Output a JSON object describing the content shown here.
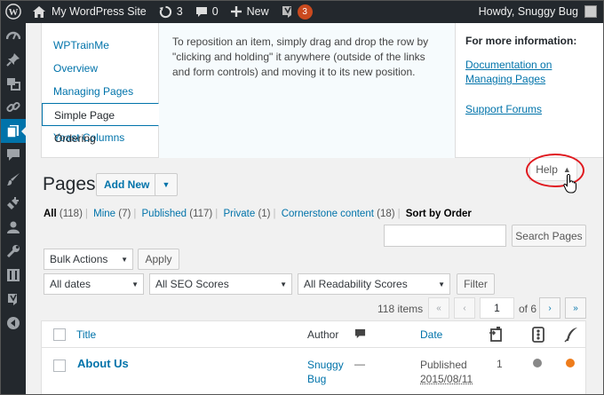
{
  "adminbar": {
    "site_name": "My WordPress Site",
    "updates_count": "3",
    "comments_count": "0",
    "new_label": "New",
    "yoast_badge": "3",
    "howdy": "Howdy, Snuggy Bug"
  },
  "help": {
    "tabs": [
      "WPTrainMe",
      "Overview",
      "Managing Pages",
      "Simple Page Ordering",
      "Yoast Columns"
    ],
    "active_tab": "Simple Page Ordering",
    "text": "To reposition an item, simply drag and drop the row by \"clicking and holding\" it anywhere (outside of the links and form controls) and moving it to its new position.",
    "side_heading": "For more information:",
    "side_links": [
      "Documentation on Managing Pages",
      "Support Forums"
    ],
    "toggle_label": "Help"
  },
  "page": {
    "title": "Pages",
    "add_new": "Add New"
  },
  "filters": {
    "all": "All",
    "all_count": "(118)",
    "mine": "Mine",
    "mine_count": "(7)",
    "published": "Published",
    "published_count": "(117)",
    "private": "Private",
    "private_count": "(1)",
    "cornerstone": "Cornerstone content",
    "cornerstone_count": "(18)",
    "sort_by_order": "Sort by Order"
  },
  "search": {
    "button": "Search Pages"
  },
  "bulk": {
    "selected": "Bulk Actions",
    "apply": "Apply"
  },
  "dropdowns": {
    "dates": "All dates",
    "seo": "All SEO Scores",
    "readability": "All Readability Scores",
    "filter": "Filter"
  },
  "pagination": {
    "items": "118 items",
    "first": "«",
    "prev": "‹",
    "current": "1",
    "of": "of 6",
    "next": "›",
    "last": "»"
  },
  "table": {
    "headers": {
      "title": "Title",
      "author": "Author",
      "date": "Date"
    },
    "rows": [
      {
        "title": "About Us",
        "author": "Snuggy Bug",
        "comments": "—",
        "status": "Published",
        "date": "2015/08/11",
        "order": "1"
      }
    ]
  },
  "colors": {
    "link": "#0073aa",
    "adminbar": "#23282d",
    "seo_dot": "#888888",
    "readability_dot": "#ee7c1b",
    "highlight_circle": "#e0191f"
  }
}
